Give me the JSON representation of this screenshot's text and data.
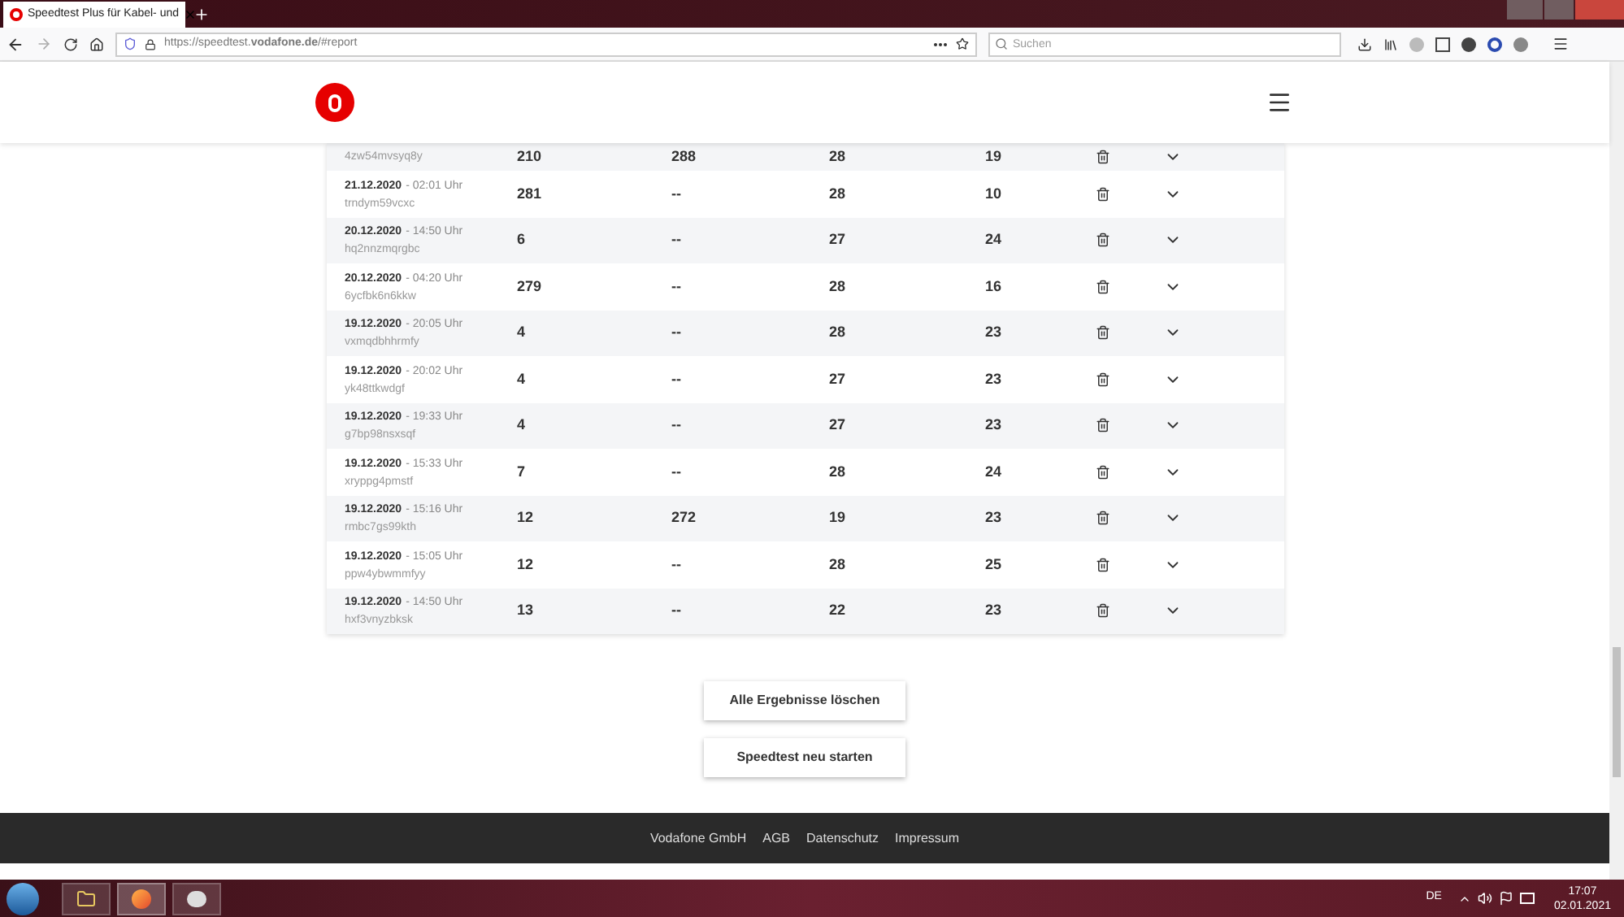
{
  "browser": {
    "tab_title": "Speedtest Plus für Kabel- und",
    "url": "https://speedtest.**vodafone.de**/#report",
    "search": {
      "placeholder": "Suchen"
    }
  },
  "results": [
    {
      "id": "4zw54mvsyq8y",
      "download": "210",
      "col_3": "288",
      "col_4": "28",
      "col_5": "19"
    },
    {
      "date": "21.12.2020",
      "time": "- 02:01 Uhr",
      "id": "trndym59vcxc",
      "download": "281",
      "col_3": "--",
      "col_4": "28",
      "col_5": "10"
    },
    {
      "date": "20.12.2020",
      "time": "- 14:50 Uhr",
      "id": "hq2nnzmqrgbc",
      "download": "6",
      "col_3": "--",
      "col_4": "27",
      "col_5": "24"
    },
    {
      "date": "20.12.2020",
      "time": "- 04:20 Uhr",
      "id": "6ycfbk6n6kkw",
      "download": "279",
      "col_3": "--",
      "col_4": "28",
      "col_5": "16"
    },
    {
      "date": "19.12.2020",
      "time": "- 20:05 Uhr",
      "id": "vxmqdbhhrmfy",
      "download": "4",
      "col_3": "--",
      "col_4": "28",
      "col_5": "23"
    },
    {
      "date": "19.12.2020",
      "time": "- 20:02 Uhr",
      "id": "yk48ttkwdgf",
      "download": "4",
      "col_3": "--",
      "col_4": "27",
      "col_5": "23"
    },
    {
      "date": "19.12.2020",
      "time": "- 19:33 Uhr",
      "id": "g7bp98nsxsqf",
      "download": "4",
      "col_3": "--",
      "col_4": "27",
      "col_5": "23"
    },
    {
      "date": "19.12.2020",
      "time": "- 15:33 Uhr",
      "id": "xryppg4pmstf",
      "download": "7",
      "col_3": "--",
      "col_4": "28",
      "col_5": "24"
    },
    {
      "date": "19.12.2020",
      "time": "- 15:16 Uhr",
      "id": "rmbc7gs99kth",
      "download": "12",
      "col_3": "272",
      "col_4": "19",
      "col_5": "23"
    },
    {
      "date": "19.12.2020",
      "time": "- 15:05 Uhr",
      "id": "ppw4ybwmmfyy",
      "download": "12",
      "col_3": "--",
      "col_4": "28",
      "col_5": "25"
    },
    {
      "date": "19.12.2020",
      "time": "- 14:50 Uhr",
      "id": "hxf3vnyzbksk",
      "download": "13",
      "col_3": "--",
      "col_4": "22",
      "col_5": "23"
    }
  ],
  "buttons": [
    "Alle Ergebnisse löschen",
    "Speedtest neu starten"
  ],
  "footer_links": [
    "Vodafone GmbH",
    "AGB",
    "Datenschutz",
    "Impressum"
  ],
  "taskbar": {
    "language": "DE",
    "time": "17:07",
    "date": "02.01.2021"
  }
}
